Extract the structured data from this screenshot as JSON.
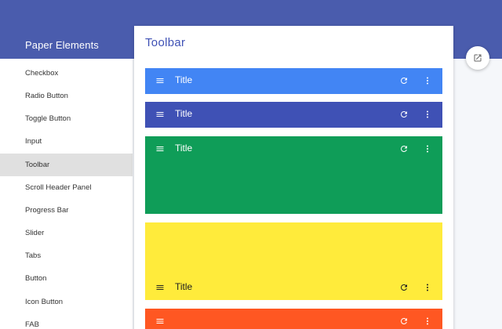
{
  "sidebar": {
    "title": "Paper Elements",
    "items": [
      {
        "label": "Checkbox"
      },
      {
        "label": "Radio Button"
      },
      {
        "label": "Toggle Button"
      },
      {
        "label": "Input"
      },
      {
        "label": "Toolbar",
        "selected": true
      },
      {
        "label": "Scroll Header Panel"
      },
      {
        "label": "Progress Bar"
      },
      {
        "label": "Slider"
      },
      {
        "label": "Tabs"
      },
      {
        "label": "Button"
      },
      {
        "label": "Icon Button"
      },
      {
        "label": "FAB"
      }
    ]
  },
  "main": {
    "title": "Toolbar",
    "toolbars": [
      {
        "title": "Title",
        "color": "#4285f4",
        "text_color": "#ffffff",
        "icons": [
          "menu-icon",
          "refresh-icon",
          "more-vert-icon"
        ]
      },
      {
        "title": "Title",
        "color": "#3f51b5",
        "text_color": "#ffffff",
        "icons": [
          "menu-icon",
          "refresh-icon",
          "more-vert-icon"
        ]
      },
      {
        "title": "Title",
        "color": "#0f9d58",
        "text_color": "#ffffff",
        "icons": [
          "menu-icon",
          "refresh-icon",
          "more-vert-icon"
        ]
      },
      {
        "title": "Title",
        "color": "#ffeb3b",
        "text_color": "#212121",
        "icons": [
          "menu-icon",
          "refresh-icon",
          "more-vert-icon"
        ]
      },
      {
        "title": "",
        "color": "#ff5722",
        "text_color": "#ffffff",
        "icons": [
          "menu-icon",
          "refresh-icon",
          "more-vert-icon"
        ]
      }
    ]
  },
  "actions": {
    "open_in_new_icon": "open-in-new-icon"
  },
  "colors": {
    "header": "#4a5cad",
    "selected_item": "#e0e0e0",
    "accent": "#3f51b5"
  }
}
